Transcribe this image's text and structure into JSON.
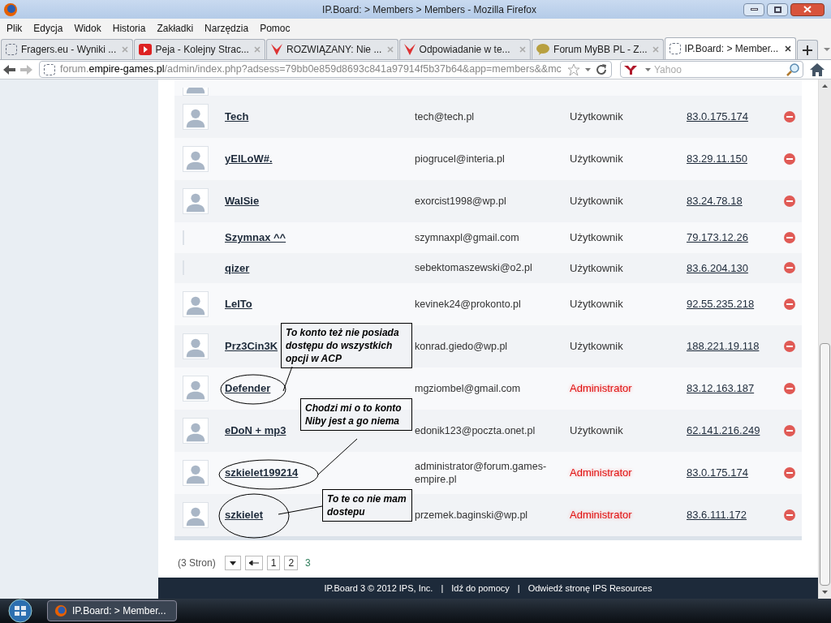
{
  "window": {
    "title": "IP.Board: > Members > Members - Mozilla Firefox"
  },
  "menu": [
    "Plik",
    "Edycja",
    "Widok",
    "Historia",
    "Zakładki",
    "Narzędzia",
    "Pomoc"
  ],
  "tabs": [
    {
      "label": "Fragers.eu - Wyniki ...",
      "kind": "blank",
      "selected": false
    },
    {
      "label": "Peja - Kolejny Strac...",
      "kind": "video",
      "selected": false
    },
    {
      "label": "ROZWIĄZANY: Nie ...",
      "kind": "mark",
      "selected": false
    },
    {
      "label": "Odpowiadanie w te...",
      "kind": "mark",
      "selected": false
    },
    {
      "label": "Forum MyBB PL - Z...",
      "kind": "bubble",
      "selected": false
    },
    {
      "label": "IP.Board: > Member...",
      "kind": "blank",
      "selected": true
    }
  ],
  "address": "forum.**empire-games.pl**/admin/index.php?adsess=79bb0e859d8693c841a97914f5b37b64&app=members&&mc",
  "search": {
    "placeholder": "Yahoo"
  },
  "members": [
    {
      "name": "Tech",
      "email": "tech@tech.pl",
      "group": "Użytkownik",
      "highlighted": false,
      "ip": "83.0.175.174",
      "has_avatar": true
    },
    {
      "name": "yElLoW#.",
      "email": "piogrucel@interia.pl",
      "group": "Użytkownik",
      "highlighted": false,
      "ip": "83.29.11.150",
      "has_avatar": true
    },
    {
      "name": "WalSie",
      "email": "exorcist1998@wp.pl",
      "group": "Użytkownik",
      "highlighted": false,
      "ip": "83.24.78.18",
      "has_avatar": true
    },
    {
      "name": "Szymnax ^^",
      "email": "szymnaxpl@gmail.com",
      "group": "Użytkownik",
      "highlighted": false,
      "ip": "79.173.12.26",
      "has_avatar": false
    },
    {
      "name": "qizer",
      "email": "sebektomaszewski@o2.pl",
      "group": "Użytkownik",
      "highlighted": false,
      "ip": "83.6.204.130",
      "has_avatar": false
    },
    {
      "name": "LelTo",
      "email": "kevinek24@prokonto.pl",
      "group": "Użytkownik",
      "highlighted": false,
      "ip": "92.55.235.218",
      "has_avatar": true
    },
    {
      "name": "Prz3Cin3K",
      "email": "konrad.giedo@wp.pl",
      "group": "Użytkownik",
      "highlighted": false,
      "ip": "188.221.19.118",
      "has_avatar": true
    },
    {
      "name": "Defender",
      "email": "mgziombel@gmail.com",
      "group": "Administrator",
      "highlighted": true,
      "ip": "83.12.163.187",
      "has_avatar": true
    },
    {
      "name": "eDoN + mp3",
      "email": "edonik123@poczta.onet.pl",
      "group": "Użytkownik",
      "highlighted": false,
      "ip": "62.141.216.249",
      "has_avatar": true
    },
    {
      "name": "szkielet199214",
      "email": "administrator@forum.games-empire.pl",
      "group": "Administrator",
      "highlighted": true,
      "ip": "83.0.175.174",
      "has_avatar": true
    },
    {
      "name": "szkielet",
      "email": "przemek.baginski@wp.pl",
      "group": "Administrator",
      "highlighted": true,
      "ip": "83.6.111.172",
      "has_avatar": true
    }
  ],
  "annotations": [
    {
      "text": "To konto też nie posiada dostępu do wszystkich opcji w ACP"
    },
    {
      "text": "Chodzi mi o to konto Niby jest a go niema"
    },
    {
      "text": "To te co nie mam dostepu"
    }
  ],
  "pagination": {
    "summary": "(3 Stron)",
    "pages": [
      {
        "label": "1",
        "selected": false
      },
      {
        "label": "2",
        "selected": false
      },
      {
        "label": "3",
        "selected": true
      }
    ]
  },
  "footer": {
    "items": [
      "IP.Board 3 © 2012 IPS, Inc.",
      "Idź do pomocy",
      "Odwiedź stronę IPS Resources"
    ],
    "separator": "|"
  },
  "taskbar": {
    "items": [
      {
        "label": "IP.Board: > Member...",
        "selected": true
      }
    ]
  }
}
